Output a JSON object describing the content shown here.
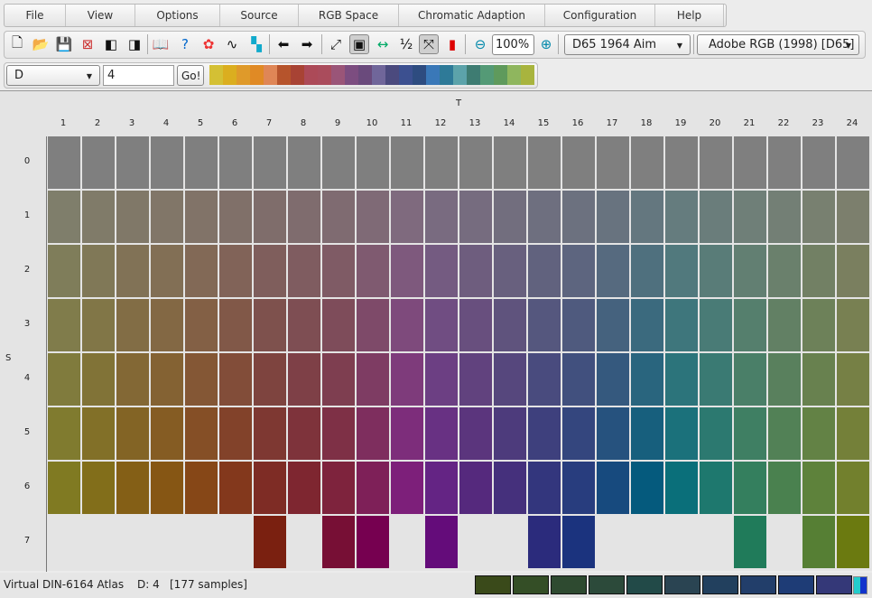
{
  "menu": [
    "File",
    "View",
    "Options",
    "Source",
    "RGB Space",
    "Chromatic Adaption",
    "Configuration",
    "Help"
  ],
  "toolbar": {
    "icons": [
      "new-file-icon",
      "open-folder-icon",
      "save-icon",
      "delete-save-icon",
      "import-icon",
      "export-icon",
      "book-icon",
      "help-icon",
      "color-wheel-icon",
      "curve-icon",
      "color-blocks-icon",
      "arrow-left-icon",
      "arrow-right-icon",
      "rotate-icon",
      "size-icon",
      "fit-width-icon",
      "half-icon",
      "fullscreen-icon",
      "color-compare-icon",
      "zoom-out-icon",
      "zoom-in-icon"
    ],
    "zoom": "100%",
    "illuminant": "D65 1964 Aim",
    "rgb_space": "Adobe RGB (1998) [D65]"
  },
  "selector": {
    "dimension": "D",
    "value": "4",
    "go": "Go!"
  },
  "palette": [
    "#d4c034",
    "#dbae1f",
    "#df9a2a",
    "#e08a25",
    "#df8656",
    "#b6542c",
    "#a84334",
    "#ac4a58",
    "#aa4c5c",
    "#9a5578",
    "#7c4d80",
    "#6a4a7c",
    "#70669a",
    "#4b4a7e",
    "#3c5090",
    "#2e4c80",
    "#3a78b8",
    "#2e7a98",
    "#5ca3aa",
    "#3e7c72",
    "#549a76",
    "#5f9a5c",
    "#8fb65e",
    "#a8b43e"
  ],
  "grid": {
    "x_axis_label": "T",
    "y_axis_label": "S",
    "columns": [
      "1",
      "2",
      "3",
      "4",
      "5",
      "6",
      "7",
      "8",
      "9",
      "10",
      "11",
      "12",
      "13",
      "14",
      "15",
      "16",
      "17",
      "18",
      "19",
      "20",
      "21",
      "22",
      "23",
      "24"
    ],
    "rows": [
      "0",
      "1",
      "2",
      "3",
      "4",
      "5",
      "6",
      "7"
    ],
    "neutral": "#7f7f7f",
    "row6": [
      "#807a22",
      "#826e1a",
      "#845f16",
      "#865614",
      "#864717",
      "#83381c",
      "#7e2c25",
      "#7e2630",
      "#7e233d",
      "#7e2058",
      "#7d1f7a",
      "#642484",
      "#55297d",
      "#45307c",
      "#33367d",
      "#283d7e",
      "#174a7e",
      "#055a7d",
      "#0a6f7a",
      "#1e786e",
      "#347f5e",
      "#4a814f",
      "#5e823b",
      "#72802d"
    ],
    "row7": [
      null,
      null,
      null,
      null,
      null,
      null,
      "#7a2010",
      null,
      "#770f35",
      "#760050",
      null,
      "#640c7a",
      null,
      null,
      "#2b2b7c",
      "#1b337e",
      null,
      null,
      null,
      null,
      "#207b5a",
      null,
      "#567f34",
      "#6b7a10"
    ]
  },
  "status": {
    "atlas": "Virtual DIN-6164 Atlas",
    "d": "D: 4",
    "samples": "[177 samples]",
    "swatches": [
      "#3a4a1a",
      "#344e26",
      "#2e4a30",
      "#2c4a3a",
      "#224a48",
      "#2a4452",
      "#22405e",
      "#223e6a",
      "#1e3c76",
      "#343878"
    ]
  }
}
